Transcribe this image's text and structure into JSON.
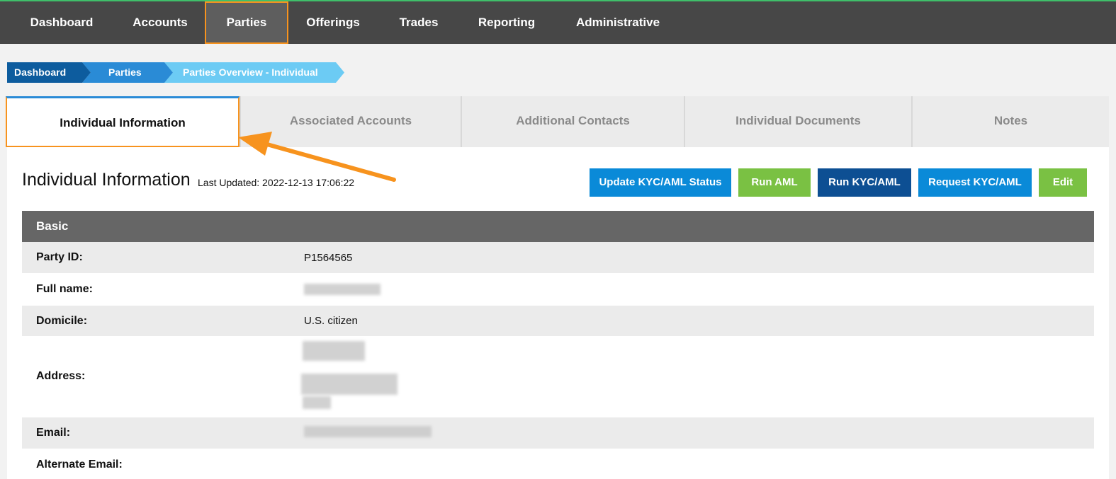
{
  "nav": {
    "items": [
      "Dashboard",
      "Accounts",
      "Parties",
      "Offerings",
      "Trades",
      "Reporting",
      "Administrative"
    ],
    "active": "Parties"
  },
  "breadcrumb": [
    "Dashboard",
    "Parties",
    "Parties Overview - Individual"
  ],
  "tabs": [
    "Individual Information",
    "Associated Accounts",
    "Additional Contacts",
    "Individual Documents",
    "Notes"
  ],
  "page": {
    "title": "Individual Information",
    "last_updated": "Last Updated: 2022-12-13 17:06:22"
  },
  "buttons": {
    "update_kyc": "Update KYC/AML Status",
    "run_aml": "Run AML",
    "run_kyc": "Run KYC/AML",
    "request_kyc": "Request KYC/AML",
    "edit": "Edit"
  },
  "section": {
    "title": "Basic",
    "rows": [
      {
        "label": "Party ID:",
        "value": "P1564565"
      },
      {
        "label": "Full name:",
        "value": ""
      },
      {
        "label": "Domicile:",
        "value": "U.S. citizen"
      },
      {
        "label": "Address:",
        "value": ""
      },
      {
        "label": "Email:",
        "value": ""
      },
      {
        "label": "Alternate Email:",
        "value": ""
      }
    ]
  },
  "colors": {
    "nav_bg": "#474747",
    "highlight": "#f7931e",
    "blue_btn": "#0a8ad8",
    "green_btn": "#7ac143",
    "dark_blue_btn": "#0d4f93"
  }
}
